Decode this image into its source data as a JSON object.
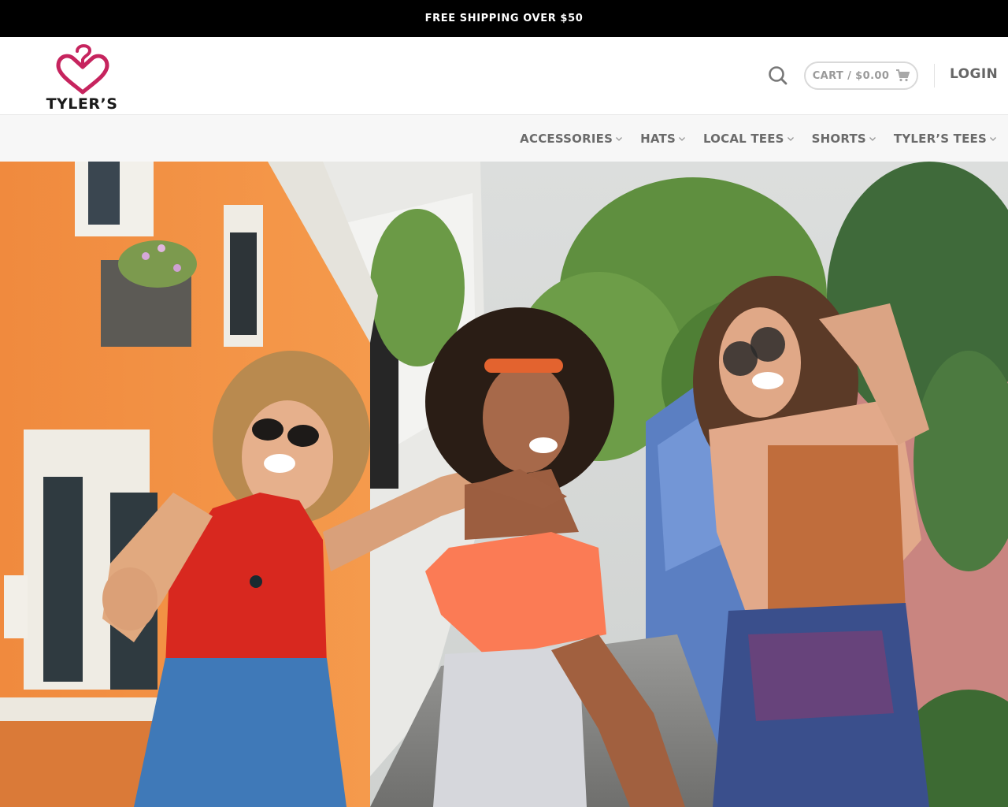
{
  "announcement": {
    "text": "FREE SHIPPING OVER $50"
  },
  "header": {
    "brand": "TYLER’S",
    "cart_label": "CART / $0.00",
    "login_label": "LOGIN"
  },
  "nav": {
    "items": [
      {
        "label": "ACCESSORIES"
      },
      {
        "label": "HATS"
      },
      {
        "label": "LOCAL TEES"
      },
      {
        "label": "SHORTS"
      },
      {
        "label": "TYLER’S TEES"
      }
    ]
  },
  "icons": {
    "logo": "heart-hanger-logo",
    "search": "search-icon",
    "cart": "cart-icon",
    "chevron": "chevron-down-icon"
  },
  "colors": {
    "brand_pink": "#c6245e",
    "topbar_bg": "#000000",
    "nav_bg": "#f7f7f7"
  },
  "hero": {
    "image": "three-friends-laughing-street-photo"
  }
}
